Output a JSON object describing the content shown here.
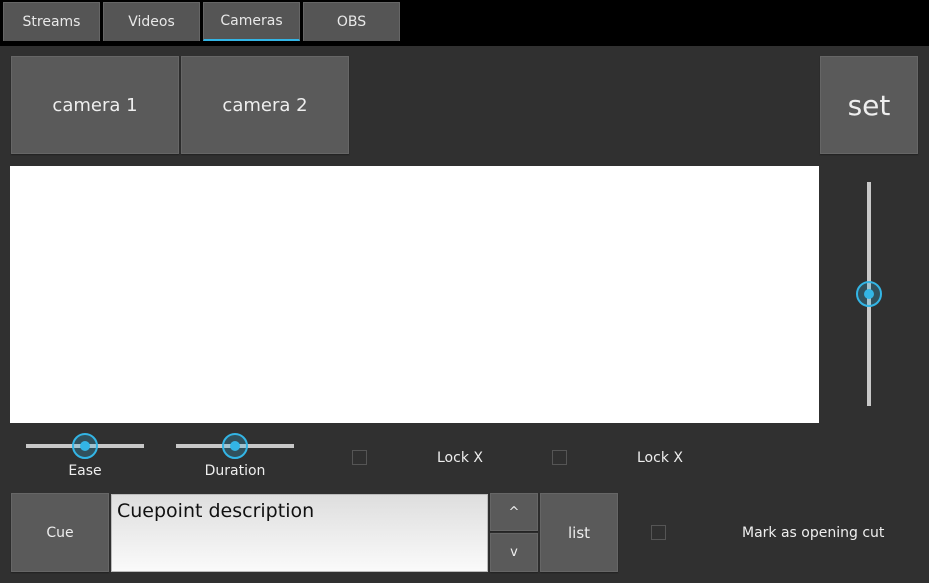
{
  "tabs": [
    {
      "label": "Streams",
      "active": false
    },
    {
      "label": "Videos",
      "active": false
    },
    {
      "label": "Cameras",
      "active": true
    },
    {
      "label": "OBS",
      "active": false
    }
  ],
  "camera_buttons": [
    "camera 1",
    "camera 2"
  ],
  "set_button": "set",
  "zoom_slider": {
    "value_fraction": 0.5
  },
  "ease_slider": {
    "label": "Ease",
    "value_fraction": 0.5
  },
  "duration_slider": {
    "label": "Duration",
    "value_fraction": 0.5
  },
  "lock_x_1": {
    "label": "Lock X",
    "checked": false
  },
  "lock_x_2": {
    "label": "Lock X",
    "checked": false
  },
  "cue_button": "Cue",
  "cuepoint": {
    "value": "Cuepoint description"
  },
  "up_button": "^",
  "down_button": "v",
  "list_button": "list",
  "opening_cut": {
    "label": "Mark as opening cut",
    "checked": false
  },
  "colors": {
    "accent": "#33b5e5",
    "panel": "#303030",
    "button": "#5a5a5a"
  }
}
